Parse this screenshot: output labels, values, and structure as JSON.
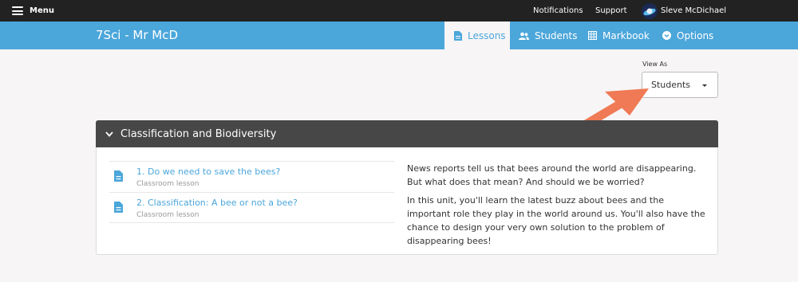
{
  "topbar": {
    "menu_label": "Menu",
    "notifications_label": "Notifications",
    "support_label": "Support",
    "user_name": "Sleve McDichael"
  },
  "header": {
    "class_title": "7Sci - Mr McD",
    "tabs": [
      {
        "label": "Lessons",
        "icon": "document-icon",
        "active": true
      },
      {
        "label": "Students",
        "icon": "users-icon",
        "active": false
      },
      {
        "label": "Markbook",
        "icon": "grid-icon",
        "active": false
      },
      {
        "label": "Options",
        "icon": "chevron-circle-icon",
        "active": false
      }
    ]
  },
  "view_as": {
    "label": "View As",
    "selected": "Students"
  },
  "unit": {
    "title": "Classification and Biodiversity",
    "lessons": [
      {
        "title": "1. Do we need to save the bees?",
        "type": "Classroom lesson"
      },
      {
        "title": "2. Classification: A bee or not a bee?",
        "type": "Classroom lesson"
      }
    ],
    "description": [
      "News reports tell us that bees around the world are disappearing. But what does that mean? And should we be worried?",
      "In this unit, you'll learn the latest buzz about bees and the important role they play in the world around us. You'll also have the chance to design your very own solution to the problem of disappearing bees!"
    ]
  },
  "colors": {
    "topbar": "#222222",
    "accent": "#4ba6da",
    "panel_header": "#474747",
    "annotation_arrow": "#ef7a55"
  }
}
